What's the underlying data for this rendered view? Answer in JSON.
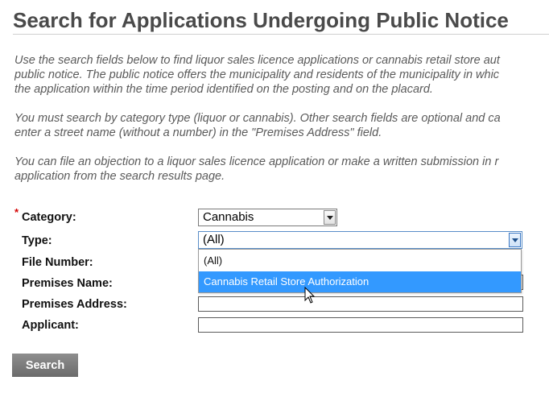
{
  "page": {
    "title": "Search for Applications Undergoing Public Notice"
  },
  "intro": {
    "p1": [
      "Use the search fields below to find liquor sales licence applications or cannabis retail store aut",
      "public notice. The public notice offers the municipality and residents of the municipality in whic",
      "the application within the time period identified on the posting and on the placard."
    ],
    "p2": [
      "You must search by category type (liquor or cannabis). Other search fields are optional and ca",
      "enter a street name (without a number) in the \"Premises Address\" field."
    ],
    "p3": [
      "You can file an objection to a liquor sales licence application or make a written submission in r",
      "application from the search results page."
    ]
  },
  "form": {
    "required_marker": "*",
    "category": {
      "label": "Category:",
      "value": "Cannabis"
    },
    "type": {
      "label": "Type:",
      "value": "(All)",
      "options": [
        "(All)",
        "Cannabis Retail Store Authorization"
      ],
      "highlighted_option": "Cannabis Retail Store Authorization"
    },
    "file_number": {
      "label": "File Number:",
      "value": ""
    },
    "premises_name": {
      "label": "Premises Name:",
      "value": ""
    },
    "premises_address": {
      "label": "Premises Address:",
      "value": ""
    },
    "applicant": {
      "label": "Applicant:",
      "value": ""
    },
    "search_button": "Search"
  },
  "icons": {
    "dropdown_arrow": "chevron-down-icon",
    "cursor": "mouse-pointer-icon"
  },
  "colors": {
    "title": "#4a4a4a",
    "body_text": "#5a5a5a",
    "required": "#d40000",
    "highlight": "#3399ff",
    "button": "#7a7a7a"
  }
}
